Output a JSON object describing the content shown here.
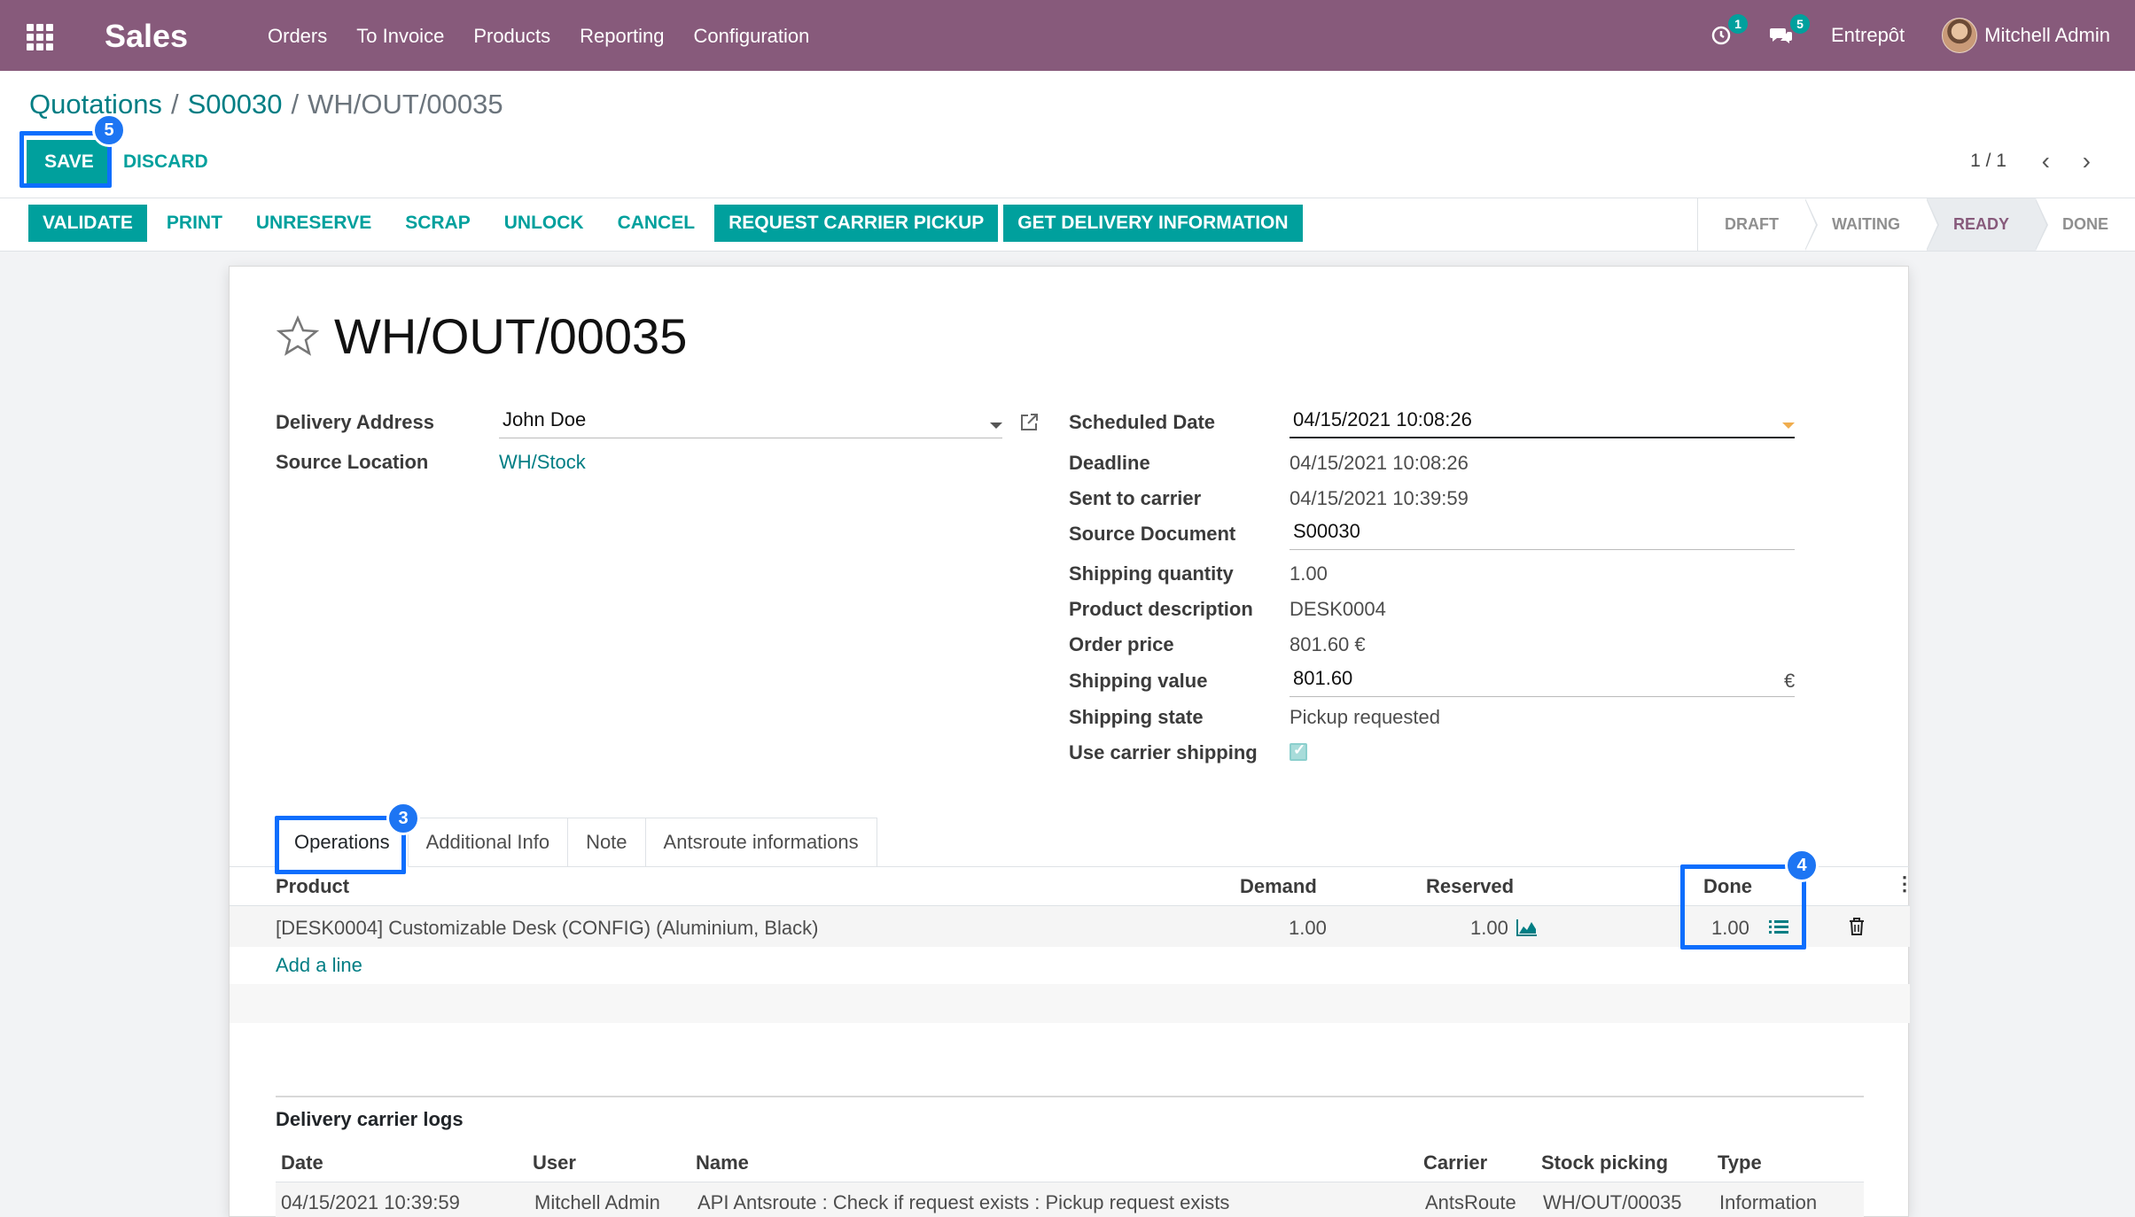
{
  "navbar": {
    "app_name": "Sales",
    "menu": [
      "Orders",
      "To Invoice",
      "Products",
      "Reporting",
      "Configuration"
    ],
    "activity_count": "1",
    "messages_count": "5",
    "company": "Entrepôt",
    "user": "Mitchell Admin"
  },
  "breadcrumb": [
    "Quotations",
    "S00030",
    "WH/OUT/00035"
  ],
  "control": {
    "save_label": "SAVE",
    "discard_label": "DISCARD",
    "pager": "1 / 1"
  },
  "actions": [
    "VALIDATE",
    "PRINT",
    "UNRESERVE",
    "SCRAP",
    "UNLOCK",
    "CANCEL",
    "REQUEST CARRIER PICKUP",
    "GET DELIVERY INFORMATION"
  ],
  "stages": [
    "DRAFT",
    "WAITING",
    "READY",
    "DONE"
  ],
  "active_stage": "READY",
  "record": {
    "title": "WH/OUT/00035"
  },
  "left_fields": {
    "delivery_address_label": "Delivery Address",
    "delivery_address_value": "John Doe",
    "source_location_label": "Source Location",
    "source_location_value": "WH/Stock"
  },
  "right_fields": [
    {
      "label": "Scheduled Date",
      "value": "04/15/2021 10:08:26"
    },
    {
      "label": "Deadline",
      "value": "04/15/2021 10:08:26"
    },
    {
      "label": "Sent to carrier",
      "value": "04/15/2021 10:39:59"
    },
    {
      "label": "Source Document",
      "value": "S00030"
    },
    {
      "label": "Shipping quantity",
      "value": "1.00"
    },
    {
      "label": "Product description",
      "value": "DESK0004"
    },
    {
      "label": "Order price",
      "value": "801.60 €"
    },
    {
      "label": "Shipping value",
      "value": "801.60",
      "suffix": "€"
    },
    {
      "label": "Shipping state",
      "value": "Pickup requested"
    },
    {
      "label": "Use carrier shipping",
      "checked": true
    }
  ],
  "tabs": [
    "Operations",
    "Additional Info",
    "Note",
    "Antsroute informations"
  ],
  "operations": {
    "headers": {
      "product": "Product",
      "demand": "Demand",
      "reserved": "Reserved",
      "done": "Done"
    },
    "row": {
      "product": "[DESK0004] Customizable Desk (CONFIG) (Aluminium, Black)",
      "demand": "1.00",
      "reserved": "1.00",
      "done": "1.00"
    },
    "add_line": "Add a line"
  },
  "logs": {
    "title": "Delivery carrier logs",
    "headers": [
      "Date",
      "User",
      "Name",
      "Carrier",
      "Stock picking",
      "Type"
    ],
    "row": [
      "04/15/2021 10:39:59",
      "Mitchell Admin",
      "API Antsroute : Check if request exists : Pickup request exists",
      "AntsRoute",
      "WH/OUT/00035",
      "Information"
    ]
  },
  "annotations": {
    "save_step": "5",
    "operations_step": "3",
    "done_step": "4"
  },
  "colors": {
    "navbar": "#875a7b",
    "primary": "#00a09d",
    "link": "#017e84",
    "highlight": "#0d6efd"
  }
}
